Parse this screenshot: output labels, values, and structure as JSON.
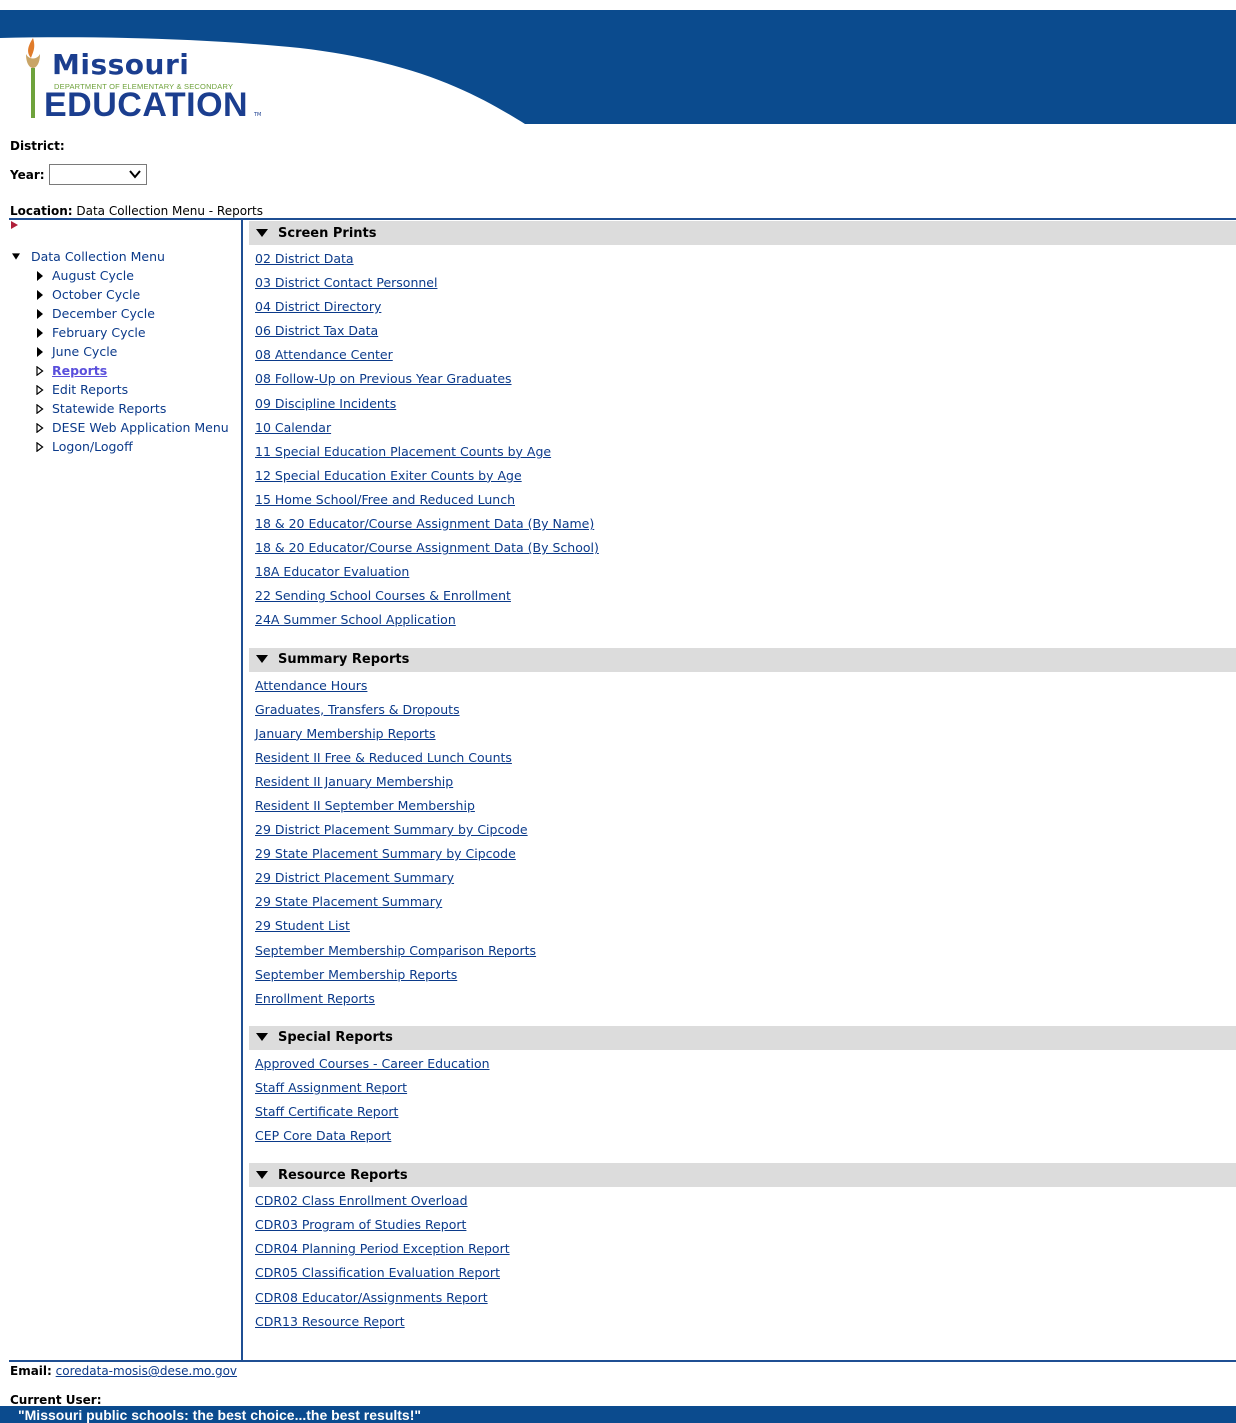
{
  "header": {
    "logo_top": "Missouri",
    "logo_dept": "DEPARTMENT OF ELEMENTARY & SECONDARY",
    "logo_main": "EDUCATION",
    "logo_tm": "TM",
    "brand_blue": "#0b4b8e",
    "logo_green": "#6ea23b"
  },
  "filters": {
    "district_label": "District:",
    "year_label": "Year:",
    "year_value": ""
  },
  "location": {
    "label": "Location:",
    "path": "Data Collection Menu - Reports"
  },
  "sidebar": {
    "root": "Data Collection Menu",
    "items": [
      {
        "label": "August Cycle",
        "icon": "triangle-right-filled"
      },
      {
        "label": "October Cycle",
        "icon": "triangle-right-filled"
      },
      {
        "label": "December Cycle",
        "icon": "triangle-right-filled"
      },
      {
        "label": "February Cycle",
        "icon": "triangle-right-filled"
      },
      {
        "label": "June Cycle",
        "icon": "triangle-right-filled"
      },
      {
        "label": "Reports",
        "icon": "triangle-right-outline",
        "current": true
      },
      {
        "label": "Edit Reports",
        "icon": "triangle-right-outline"
      },
      {
        "label": "Statewide Reports",
        "icon": "triangle-right-outline"
      },
      {
        "label": "DESE Web Application Menu",
        "icon": "triangle-right-outline"
      },
      {
        "label": "Logon/Logoff",
        "icon": "triangle-right-outline"
      }
    ]
  },
  "sections": [
    {
      "title": "Screen Prints",
      "links": [
        "02 District Data",
        "03 District Contact Personnel",
        "04 District Directory",
        "06 District Tax Data",
        "08 Attendance Center",
        "08 Follow-Up on Previous Year Graduates",
        "09 Discipline Incidents",
        "10 Calendar",
        "11 Special Education Placement Counts by Age",
        "12 Special Education Exiter Counts by Age",
        "15 Home School/Free and Reduced Lunch",
        "18 & 20 Educator/Course Assignment Data (By Name)",
        "18 & 20 Educator/Course Assignment Data (By School)",
        "18A Educator Evaluation",
        "22 Sending School Courses & Enrollment",
        "24A Summer School Application"
      ]
    },
    {
      "title": "Summary Reports",
      "links": [
        "Attendance Hours",
        "Graduates, Transfers & Dropouts",
        "January Membership Reports",
        "Resident II Free & Reduced Lunch Counts",
        "Resident II January Membership",
        "Resident II September Membership",
        "29 District Placement Summary by Cipcode",
        "29 State Placement Summary by Cipcode",
        "29 District Placement Summary",
        "29 State Placement Summary",
        "29 Student List",
        "September Membership Comparison Reports",
        "September Membership Reports",
        "Enrollment Reports"
      ]
    },
    {
      "title": "Special Reports",
      "links": [
        "Approved Courses - Career Education",
        "Staff Assignment Report",
        "Staff Certificate Report",
        "CEP Core Data Report"
      ]
    },
    {
      "title": "Resource Reports",
      "links": [
        "CDR02 Class Enrollment Overload",
        "CDR03 Program of Studies Report",
        "CDR04 Planning Period Exception Report",
        "CDR05 Classification Evaluation Report",
        "CDR08 Educator/Assignments Report",
        "CDR13 Resource Report"
      ]
    }
  ],
  "footer": {
    "email_label": "Email:",
    "email": "coredata-mosis@dese.mo.gov",
    "current_user_label": "Current User:",
    "tagline": "\"Missouri public schools: the best choice...the best results!\""
  }
}
